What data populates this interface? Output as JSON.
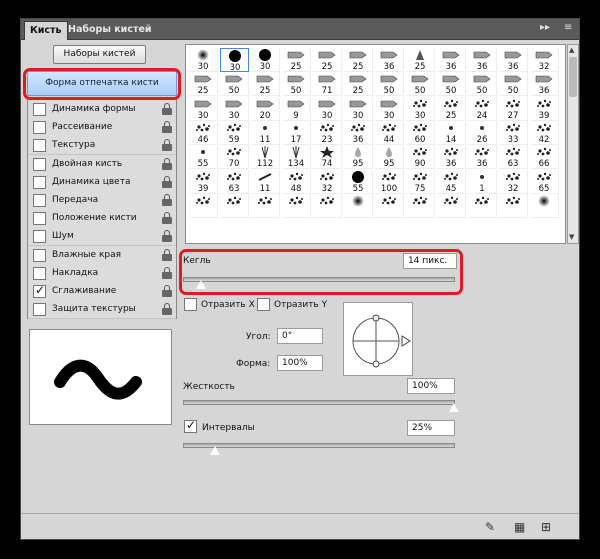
{
  "tabs": [
    {
      "label": "Кисть"
    },
    {
      "label": "Наборы кистей"
    }
  ],
  "tab_controls": {
    "collapse": "▸▸",
    "menu": "≡"
  },
  "presets_button": "Наборы кистей",
  "brush_tip_shape": "Форма отпечатка кисти",
  "options": [
    {
      "label": "Динамика формы",
      "checked": false
    },
    {
      "label": "Рассеивание",
      "checked": false
    },
    {
      "label": "Текстура",
      "checked": false
    },
    {
      "label": "Двойная кисть",
      "checked": false
    },
    {
      "label": "Динамика цвета",
      "checked": false
    },
    {
      "label": "Передача",
      "checked": false
    },
    {
      "label": "Положение кисти",
      "checked": false
    },
    {
      "label": "Шум",
      "checked": false
    },
    {
      "label": "Влажные края",
      "checked": false
    },
    {
      "label": "Накладка",
      "checked": false
    },
    {
      "label": "Сглаживание",
      "checked": true
    },
    {
      "label": "Защита текстуры",
      "checked": false
    }
  ],
  "brushes": {
    "selected_index": 1,
    "items": [
      {
        "size": "30",
        "icon": "soft-round"
      },
      {
        "size": "30",
        "icon": "hard-round"
      },
      {
        "size": "30",
        "icon": "hard-round"
      },
      {
        "size": "25",
        "icon": "chalk"
      },
      {
        "size": "25",
        "icon": "chalk"
      },
      {
        "size": "25",
        "icon": "chalk"
      },
      {
        "size": "36",
        "icon": "chalk"
      },
      {
        "size": "25",
        "icon": "cone"
      },
      {
        "size": "36",
        "icon": "chalk"
      },
      {
        "size": "36",
        "icon": "chalk"
      },
      {
        "size": "36",
        "icon": "chalk"
      },
      {
        "size": "32",
        "icon": "chalk"
      },
      {
        "size": "25",
        "icon": "chalk"
      },
      {
        "size": "50",
        "icon": "chalk"
      },
      {
        "size": "25",
        "icon": "chalk"
      },
      {
        "size": "50",
        "icon": "chalk"
      },
      {
        "size": "71",
        "icon": "chalk"
      },
      {
        "size": "25",
        "icon": "chalk"
      },
      {
        "size": "50",
        "icon": "chalk"
      },
      {
        "size": "50",
        "icon": "chalk"
      },
      {
        "size": "50",
        "icon": "chalk"
      },
      {
        "size": "50",
        "icon": "chalk"
      },
      {
        "size": "50",
        "icon": "chalk"
      },
      {
        "size": "36",
        "icon": "chalk"
      },
      {
        "size": "30",
        "icon": "chalk"
      },
      {
        "size": "30",
        "icon": "chalk"
      },
      {
        "size": "20",
        "icon": "chalk"
      },
      {
        "size": "9",
        "icon": "chalk"
      },
      {
        "size": "30",
        "icon": "chalk"
      },
      {
        "size": "30",
        "icon": "chalk"
      },
      {
        "size": "30",
        "icon": "chalk"
      },
      {
        "size": "30",
        "icon": "scatter"
      },
      {
        "size": "25",
        "icon": "scatter"
      },
      {
        "size": "24",
        "icon": "scatter"
      },
      {
        "size": "27",
        "icon": "scatter"
      },
      {
        "size": "39",
        "icon": "scatter"
      },
      {
        "size": "46",
        "icon": "scatter"
      },
      {
        "size": "59",
        "icon": "scatter"
      },
      {
        "size": "11",
        "icon": "dot"
      },
      {
        "size": "17",
        "icon": "dot"
      },
      {
        "size": "23",
        "icon": "scatter"
      },
      {
        "size": "36",
        "icon": "scatter"
      },
      {
        "size": "44",
        "icon": "scatter"
      },
      {
        "size": "60",
        "icon": "scatter"
      },
      {
        "size": "14",
        "icon": "dot"
      },
      {
        "size": "26",
        "icon": "dot"
      },
      {
        "size": "33",
        "icon": "scatter"
      },
      {
        "size": "42",
        "icon": "scatter"
      },
      {
        "size": "55",
        "icon": "dot"
      },
      {
        "size": "70",
        "icon": "scatter"
      },
      {
        "size": "112",
        "icon": "grass"
      },
      {
        "size": "134",
        "icon": "grass"
      },
      {
        "size": "74",
        "icon": "leaf"
      },
      {
        "size": "95",
        "icon": "drop"
      },
      {
        "size": "95",
        "icon": "drop"
      },
      {
        "size": "90",
        "icon": "scatter"
      },
      {
        "size": "36",
        "icon": "scatter"
      },
      {
        "size": "36",
        "icon": "scatter"
      },
      {
        "size": "63",
        "icon": "scatter"
      },
      {
        "size": "66",
        "icon": "scatter"
      },
      {
        "size": "39",
        "icon": "scatter"
      },
      {
        "size": "63",
        "icon": "scatter"
      },
      {
        "size": "11",
        "icon": "stroke"
      },
      {
        "size": "48",
        "icon": "scatter"
      },
      {
        "size": "32",
        "icon": "scatter"
      },
      {
        "size": "55",
        "icon": "hard-round"
      },
      {
        "size": "100",
        "icon": "scatter"
      },
      {
        "size": "75",
        "icon": "scatter"
      },
      {
        "size": "45",
        "icon": "scatter"
      },
      {
        "size": "1",
        "icon": "dot"
      },
      {
        "size": "32",
        "icon": "scatter"
      },
      {
        "size": "65",
        "icon": "scatter"
      }
    ],
    "partial_row": [
      "scatter",
      "scatter",
      "scatter",
      "scatter",
      "scatter",
      "soft-round",
      "scatter",
      "scatter",
      "scatter",
      "scatter",
      "scatter",
      "soft-round"
    ]
  },
  "size": {
    "label": "Кегль",
    "value": "14 пикс.",
    "slider_fraction": 0.05
  },
  "flip_x_label": "Отразить X",
  "flip_y_label": "Отразить Y",
  "angle": {
    "label": "Угол:",
    "value": "0°"
  },
  "roundness": {
    "label": "Форма:",
    "value": "100%"
  },
  "hardness": {
    "label": "Жесткость",
    "value": "100%",
    "slider_fraction": 1.0
  },
  "spacing": {
    "label": "Интервалы",
    "value": "25%",
    "checked": true,
    "slider_fraction": 0.1
  },
  "status_icons": [
    "brush-tool-icon",
    "grid-icon",
    "new-preset-icon"
  ],
  "colors": {
    "panel": "#d6d6d6",
    "highlight": "#e01b24",
    "selected": "#a9cdf8"
  }
}
